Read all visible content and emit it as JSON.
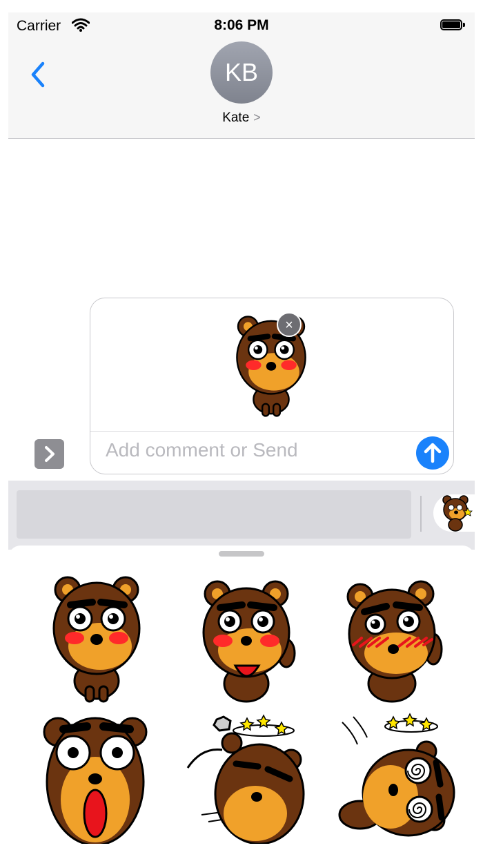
{
  "status_bar": {
    "carrier": "Carrier",
    "time": "8:06 PM"
  },
  "header": {
    "avatar_initials": "KB",
    "contact_name": "Kate",
    "contact_chevron": ">"
  },
  "compose": {
    "placeholder": "Add comment or Send",
    "remove_symbol": "×"
  },
  "stickers": [
    "bear-blushing",
    "bear-waving-happy",
    "bear-shy-waving",
    "bear-shocked",
    "bear-hit-by-rock-dizzy",
    "bear-knocked-down-dizzy"
  ],
  "colors": {
    "accent": "#1a82fb",
    "bear_brown": "#6b3410",
    "bear_muzzle": "#f0a12a",
    "blush": "#ff2a2a"
  }
}
